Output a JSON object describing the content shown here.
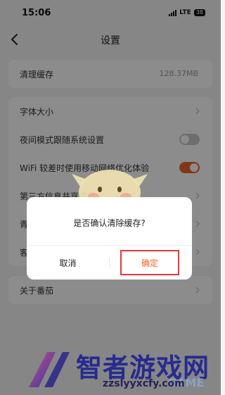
{
  "status_bar": {
    "time": "15:06",
    "network": "LTE",
    "battery": "38"
  },
  "nav": {
    "title": "设置",
    "back_icon": "chevron-left-icon"
  },
  "sections": [
    {
      "items": [
        {
          "label": "清理缓存",
          "value": "128.37MB"
        }
      ]
    },
    {
      "items": [
        {
          "label": "字体大小",
          "type": "chevron"
        },
        {
          "label": "夜间模式跟随系统设置",
          "type": "toggle",
          "on": false
        },
        {
          "label": "WiFi 较差时使用移动网络优化体验",
          "type": "toggle",
          "on": true
        },
        {
          "label": "第三方信息共享清单",
          "type": "chevron"
        },
        {
          "label": "青",
          "type": "chevron"
        },
        {
          "label": "客",
          "type": "chevron"
        }
      ]
    },
    {
      "items": [
        {
          "label": "关于番茄",
          "type": "chevron"
        }
      ]
    }
  ],
  "dialog": {
    "message": "是否确认清除缓存?",
    "cancel_label": "取消",
    "confirm_label": "确定"
  },
  "watermark": {
    "brand": "智者游戏网",
    "url": "zzslyyxcfy.com",
    "game": "GAME"
  },
  "colors": {
    "accent": "#ff5a1f",
    "toggle_on": "#e8652c",
    "toggle_off": "#c8c8c8",
    "highlight_border": "#e53935"
  }
}
